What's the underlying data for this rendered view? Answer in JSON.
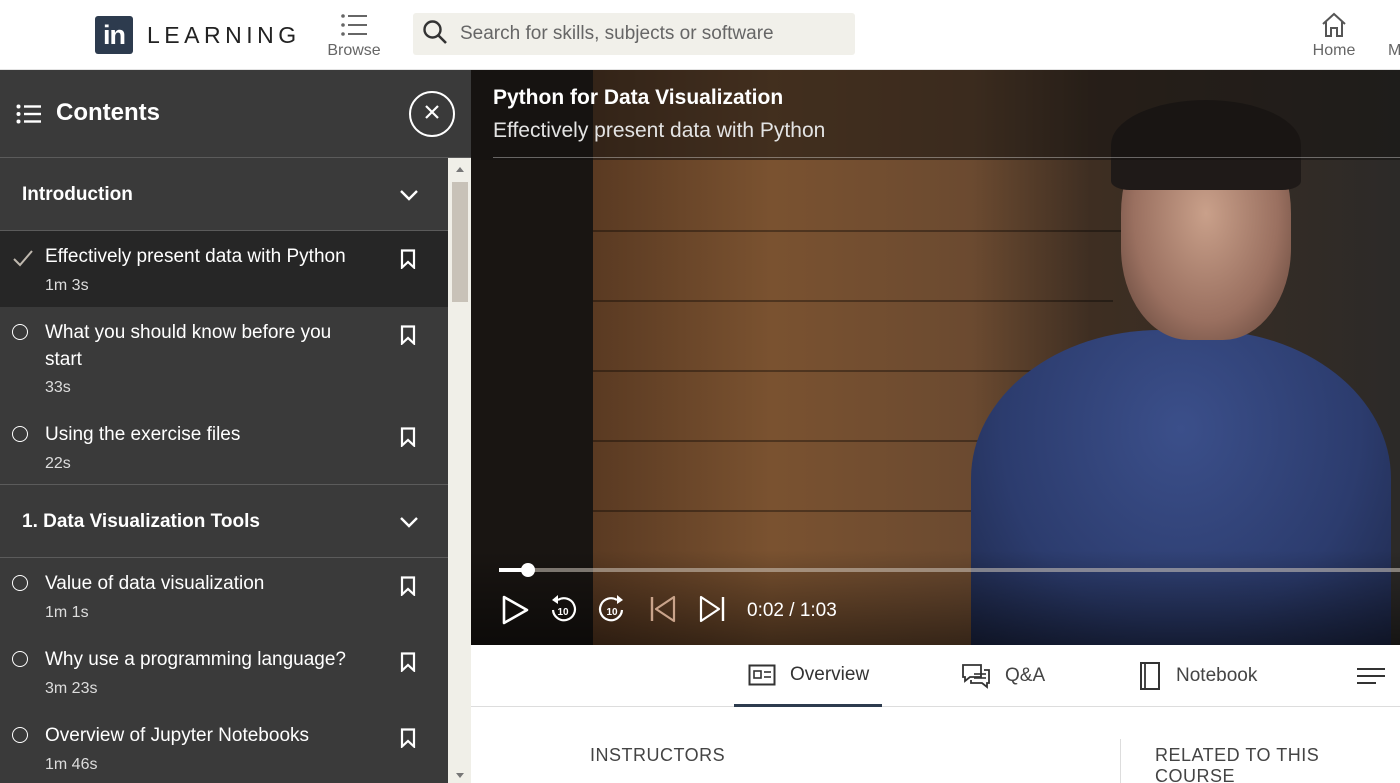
{
  "header": {
    "logo_mark": "in",
    "logo_text": "LEARNING",
    "browse_label": "Browse",
    "search_placeholder": "Search for skills, subjects or software",
    "home_label": "Home",
    "me_label": "M"
  },
  "sidebar": {
    "title": "Contents",
    "sections": [
      {
        "title": "Introduction",
        "items": [
          {
            "title": "Effectively present data with Python",
            "duration": "1m 3s",
            "status": "complete",
            "active": true
          },
          {
            "title": "What you should know before you start",
            "duration": "33s",
            "status": "incomplete",
            "active": false
          },
          {
            "title": "Using the exercise files",
            "duration": "22s",
            "status": "incomplete",
            "active": false
          }
        ]
      },
      {
        "title": "1. Data Visualization Tools",
        "items": [
          {
            "title": "Value of data visualization",
            "duration": "1m 1s",
            "status": "incomplete",
            "active": false
          },
          {
            "title": "Why use a programming language?",
            "duration": "3m 23s",
            "status": "incomplete",
            "active": false
          },
          {
            "title": "Overview of Jupyter Notebooks",
            "duration": "1m 46s",
            "status": "incomplete",
            "active": false
          }
        ]
      }
    ]
  },
  "player": {
    "course_title": "Python for Data Visualization",
    "video_title": "Effectively present data with Python",
    "time_display": "0:02 / 1:03",
    "progress_fraction": 0.032,
    "rewind_label": "10",
    "forward_label": "10"
  },
  "tabs": [
    {
      "label": "Overview",
      "icon": "overview-icon",
      "active": true
    },
    {
      "label": "Q&A",
      "icon": "qa-icon",
      "active": false
    },
    {
      "label": "Notebook",
      "icon": "notebook-icon",
      "active": false
    }
  ],
  "below": {
    "instructors_label": "INSTRUCTORS",
    "related_label": "RELATED TO THIS COURSE"
  },
  "colors": {
    "sidebar_bg": "#3a3a3a",
    "active_item_bg": "#262626",
    "brand": "#2d3b4e"
  }
}
